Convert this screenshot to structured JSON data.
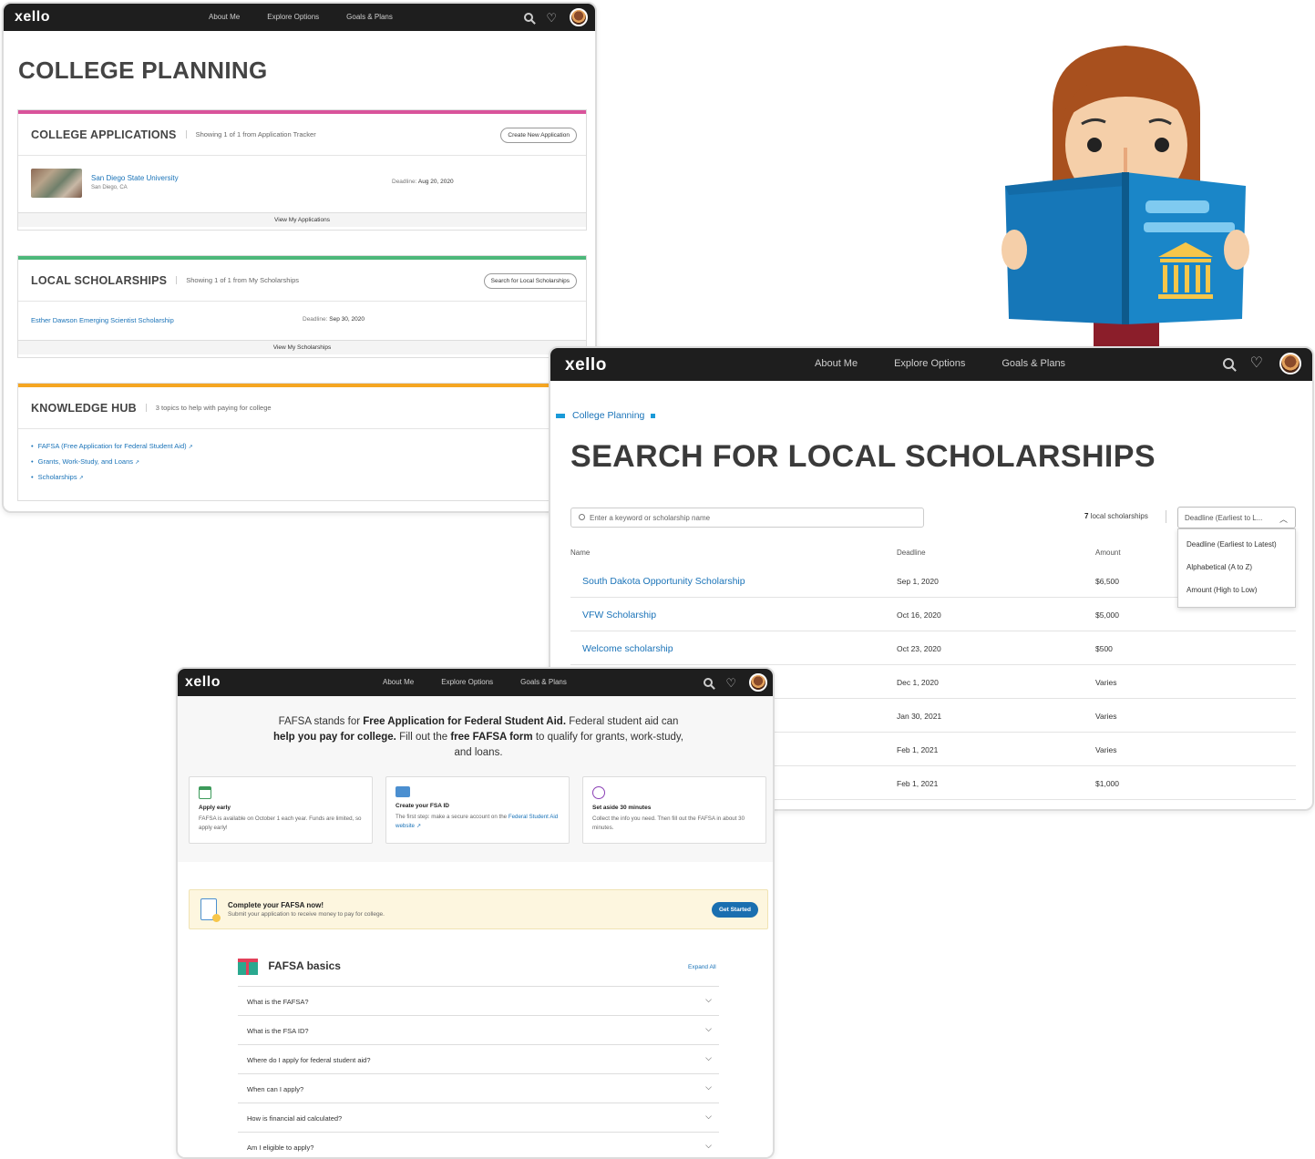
{
  "app": {
    "logo": "xello"
  },
  "nav": {
    "about": "About Me",
    "explore": "Explore Options",
    "goals": "Goals & Plans"
  },
  "college_planning": {
    "title": "COLLEGE PLANNING",
    "applications": {
      "title": "COLLEGE APPLICATIONS",
      "subtitle": "Showing 1 of 1 from Application Tracker",
      "button": "Create New Application",
      "item_name": "San Diego State University",
      "item_location": "San Diego, CA",
      "deadline_label": "Deadline:",
      "deadline": "Aug 20, 2020",
      "footer": "View My Applications",
      "accent": "#d9539b"
    },
    "scholarships": {
      "title": "LOCAL SCHOLARSHIPS",
      "subtitle": "Showing 1 of 1 from My Scholarships",
      "button": "Search for Local Scholarships",
      "item_name": "Esther Dawson Emerging Scientist Scholarship",
      "deadline_label": "Deadline:",
      "deadline": "Sep 30, 2020",
      "footer": "View My Scholarships",
      "accent": "#4cb87a"
    },
    "knowledge_hub": {
      "title": "KNOWLEDGE HUB",
      "subtitle": "3 topics to help with paying for college",
      "links": [
        "FAFSA (Free Application for Federal Student Aid)",
        "Grants, Work-Study, and Loans",
        "Scholarships"
      ],
      "accent": "#f5a623"
    }
  },
  "search_page": {
    "breadcrumb": "College Planning",
    "title": "SEARCH FOR LOCAL SCHOLARSHIPS",
    "search_placeholder": "Enter a keyword or scholarship name",
    "count_num": "7",
    "count_text": "local scholarships",
    "sort_selected": "Deadline (Earliest to L...",
    "sort_options": [
      "Deadline (Earliest to Latest)",
      "Alphabetical (A to Z)",
      "Amount (High to Low)"
    ],
    "columns": {
      "name": "Name",
      "deadline": "Deadline",
      "amount": "Amount"
    },
    "rows": [
      {
        "name": "South Dakota Opportunity Scholarship",
        "deadline": "Sep 1, 2020",
        "amount": "$6,500"
      },
      {
        "name": "VFW Scholarship",
        "deadline": "Oct 16, 2020",
        "amount": "$5,000"
      },
      {
        "name": "Welcome scholarship",
        "deadline": "Oct 23, 2020",
        "amount": "$500"
      },
      {
        "name": "",
        "deadline": "Dec 1, 2020",
        "amount": "Varies"
      },
      {
        "name": "",
        "deadline": "Jan 30, 2021",
        "amount": "Varies"
      },
      {
        "name": "",
        "deadline": "Feb 1, 2021",
        "amount": "Varies"
      },
      {
        "name": "",
        "deadline": "Feb 1, 2021",
        "amount": "$1,000"
      }
    ]
  },
  "fafsa": {
    "intro_1": "FAFSA stands for ",
    "intro_b1": "Free Application for Federal Student Aid.",
    "intro_2": " Federal student aid can ",
    "intro_b2": "help you pay for college.",
    "intro_3": " Fill out the ",
    "intro_b3": "free FAFSA form",
    "intro_4": " to qualify for grants, work-study, and loans.",
    "cards": [
      {
        "title": "Apply early",
        "text": "FAFSA is available on October 1 each year. Funds are limited, so apply early!",
        "icon": "calendar-icon",
        "link": ""
      },
      {
        "title": "Create your FSA ID",
        "text": "The first step: make a secure account on the ",
        "link": "Federal Student Aid website",
        "icon": "id-card-icon"
      },
      {
        "title": "Set aside 30 minutes",
        "text": "Collect the info you need. Then fill out the FAFSA in about 30 minutes.",
        "icon": "clock-icon",
        "link": ""
      }
    ],
    "cta": {
      "title": "Complete your FAFSA now!",
      "text": "Submit your application to receive money to pay for college.",
      "button": "Get Started"
    },
    "basics": {
      "title": "FAFSA basics",
      "expand": "Expand All",
      "faqs": [
        "What is the FAFSA?",
        "What is the FSA ID?",
        "Where do I apply for federal student aid?",
        "When can I apply?",
        "How is financial aid calculated?",
        "Am I eligible to apply?"
      ]
    }
  }
}
